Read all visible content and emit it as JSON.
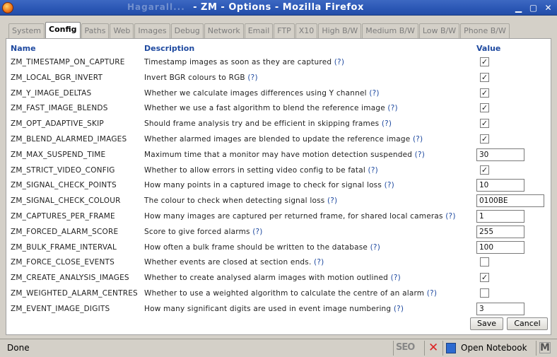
{
  "window": {
    "title": "- ZM - Options - Mozilla Firefox",
    "ghost_title": "Hagarall..."
  },
  "tabs": [
    {
      "label": "System",
      "active": false
    },
    {
      "label": "Config",
      "active": true
    },
    {
      "label": "Paths",
      "active": false
    },
    {
      "label": "Web",
      "active": false
    },
    {
      "label": "Images",
      "active": false
    },
    {
      "label": "Debug",
      "active": false
    },
    {
      "label": "Network",
      "active": false
    },
    {
      "label": "Email",
      "active": false
    },
    {
      "label": "FTP",
      "active": false
    },
    {
      "label": "X10",
      "active": false
    },
    {
      "label": "High B/W",
      "active": false
    },
    {
      "label": "Medium B/W",
      "active": false
    },
    {
      "label": "Low B/W",
      "active": false
    },
    {
      "label": "Phone B/W",
      "active": false
    }
  ],
  "table": {
    "headers": {
      "name": "Name",
      "description": "Description",
      "value": "Value"
    },
    "help_marker": "(?)",
    "rows": [
      {
        "name": "ZM_TIMESTAMP_ON_CAPTURE",
        "desc": "Timestamp images as soon as they are captured",
        "type": "checkbox",
        "checked": true
      },
      {
        "name": "ZM_LOCAL_BGR_INVERT",
        "desc": "Invert BGR colours to RGB",
        "type": "checkbox",
        "checked": true
      },
      {
        "name": "ZM_Y_IMAGE_DELTAS",
        "desc": "Whether we calculate images differences using Y channel",
        "type": "checkbox",
        "checked": true
      },
      {
        "name": "ZM_FAST_IMAGE_BLENDS",
        "desc": "Whether we use a fast algorithm to blend the reference image",
        "type": "checkbox",
        "checked": true
      },
      {
        "name": "ZM_OPT_ADAPTIVE_SKIP",
        "desc": "Should frame analysis try and be efficient in skipping frames",
        "type": "checkbox",
        "checked": true
      },
      {
        "name": "ZM_BLEND_ALARMED_IMAGES",
        "desc": "Whether alarmed images are blended to update the reference image",
        "type": "checkbox",
        "checked": true
      },
      {
        "name": "ZM_MAX_SUSPEND_TIME",
        "desc": "Maximum time that a monitor may have motion detection suspended",
        "type": "text",
        "value": "30"
      },
      {
        "name": "ZM_STRICT_VIDEO_CONFIG",
        "desc": "Whether to allow errors in setting video config to be fatal",
        "type": "checkbox",
        "checked": true
      },
      {
        "name": "ZM_SIGNAL_CHECK_POINTS",
        "desc": "How many points in a captured image to check for signal loss",
        "type": "text",
        "value": "10"
      },
      {
        "name": "ZM_SIGNAL_CHECK_COLOUR",
        "desc": "The colour to check when detecting signal loss",
        "type": "text-wide",
        "value": "0100BE"
      },
      {
        "name": "ZM_CAPTURES_PER_FRAME",
        "desc": "How many images are captured per returned frame, for shared local cameras",
        "type": "text",
        "value": "1"
      },
      {
        "name": "ZM_FORCED_ALARM_SCORE",
        "desc": "Score to give forced alarms",
        "type": "text",
        "value": "255"
      },
      {
        "name": "ZM_BULK_FRAME_INTERVAL",
        "desc": "How often a bulk frame should be written to the database",
        "type": "text",
        "value": "100"
      },
      {
        "name": "ZM_FORCE_CLOSE_EVENTS",
        "desc": "Whether events are closed at section ends.",
        "type": "checkbox",
        "checked": false
      },
      {
        "name": "ZM_CREATE_ANALYSIS_IMAGES",
        "desc": "Whether to create analysed alarm images with motion outlined",
        "type": "checkbox",
        "checked": true
      },
      {
        "name": "ZM_WEIGHTED_ALARM_CENTRES",
        "desc": "Whether to use a weighted algorithm to calculate the centre of an alarm",
        "type": "checkbox",
        "checked": false
      },
      {
        "name": "ZM_EVENT_IMAGE_DIGITS",
        "desc": "How many significant digits are used in event image numbering",
        "type": "text",
        "value": "3"
      }
    ]
  },
  "buttons": {
    "save": "Save",
    "cancel": "Cancel"
  },
  "statusbar": {
    "status": "Done",
    "seo_label": "SEO",
    "notebook_label": "Open Notebook"
  },
  "colors": {
    "header_blue": "#1f4aa0",
    "titlebar": "#2a56b4"
  }
}
